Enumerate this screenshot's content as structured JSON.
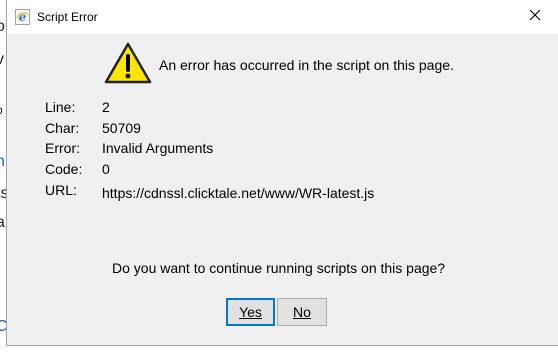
{
  "dialog": {
    "title": "Script Error",
    "message": "An error has occurred in the script on this page.",
    "details": [
      {
        "label": "Line:",
        "value": "2"
      },
      {
        "label": "Char:",
        "value": "50709"
      },
      {
        "label": "Error:",
        "value": "Invalid Arguments"
      },
      {
        "label": "Code:",
        "value": "0"
      },
      {
        "label": "URL:",
        "value": "https://cdnssl.clicktale.net/www/WR-latest.js"
      }
    ],
    "question": "Do you want to continue running scripts on this page?",
    "buttons": {
      "yes": "Yes",
      "no": "No"
    }
  },
  "icons": {
    "title": "internet-explorer-icon",
    "warning": "warning-icon",
    "close": "close-icon"
  },
  "colors": {
    "accent": "#0078d7",
    "warning_fill": "#ffe600",
    "dialog_bg": "#f0f0f0"
  }
}
